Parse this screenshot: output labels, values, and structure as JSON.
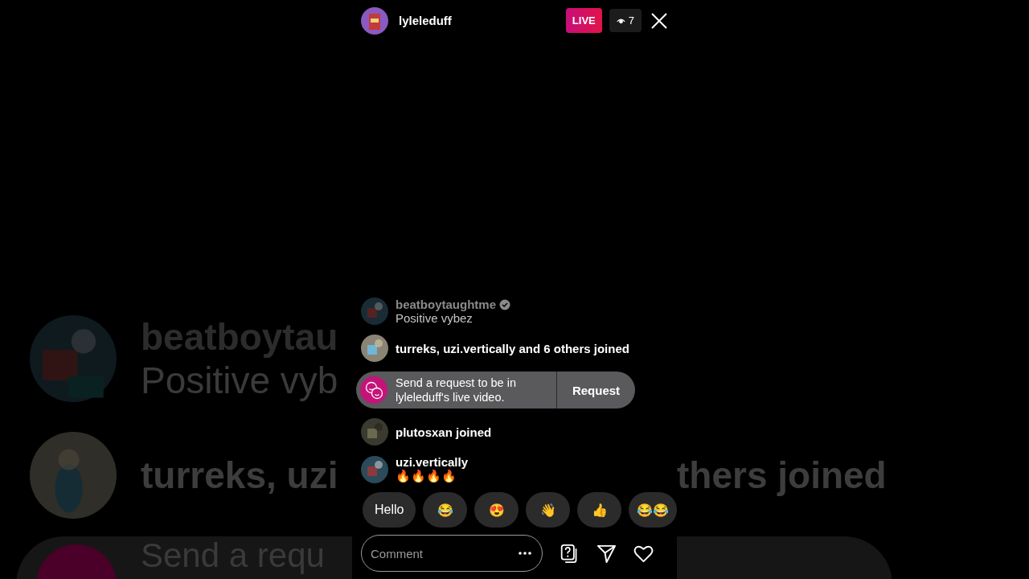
{
  "backdrop_left": {
    "rows": [
      {
        "kind": "comment",
        "user": "beatboytau",
        "text": "Positive vyb"
      },
      {
        "kind": "join",
        "text": "turreks, uzi"
      },
      {
        "kind": "request",
        "text": "Send a requ"
      }
    ]
  },
  "header": {
    "username": "lyleleduff",
    "live_badge": "LIVE",
    "viewers": "7"
  },
  "chat": [
    {
      "kind": "comment",
      "user": "beatboytaughtme",
      "verified": true,
      "faded": true,
      "text": "Positive vybez"
    },
    {
      "kind": "join",
      "text": "turreks, uzi.vertically and 6 others joined"
    },
    {
      "kind": "request",
      "text": "Send a request to be in lyleleduff's live video.",
      "button": "Request"
    },
    {
      "kind": "join",
      "text": "plutosxan joined"
    },
    {
      "kind": "comment",
      "user": "uzi.vertically",
      "verified": false,
      "faded": false,
      "text": "🔥🔥🔥🔥"
    }
  ],
  "quick_replies": [
    "Hello",
    "😂",
    "😍",
    "👋",
    "👍",
    "😂😂"
  ],
  "comment_field": {
    "placeholder": "Comment"
  },
  "backdrop_right": {
    "rows": [
      {
        "kind": "join",
        "text": "thers joined"
      },
      {
        "kind": "request"
      }
    ]
  }
}
